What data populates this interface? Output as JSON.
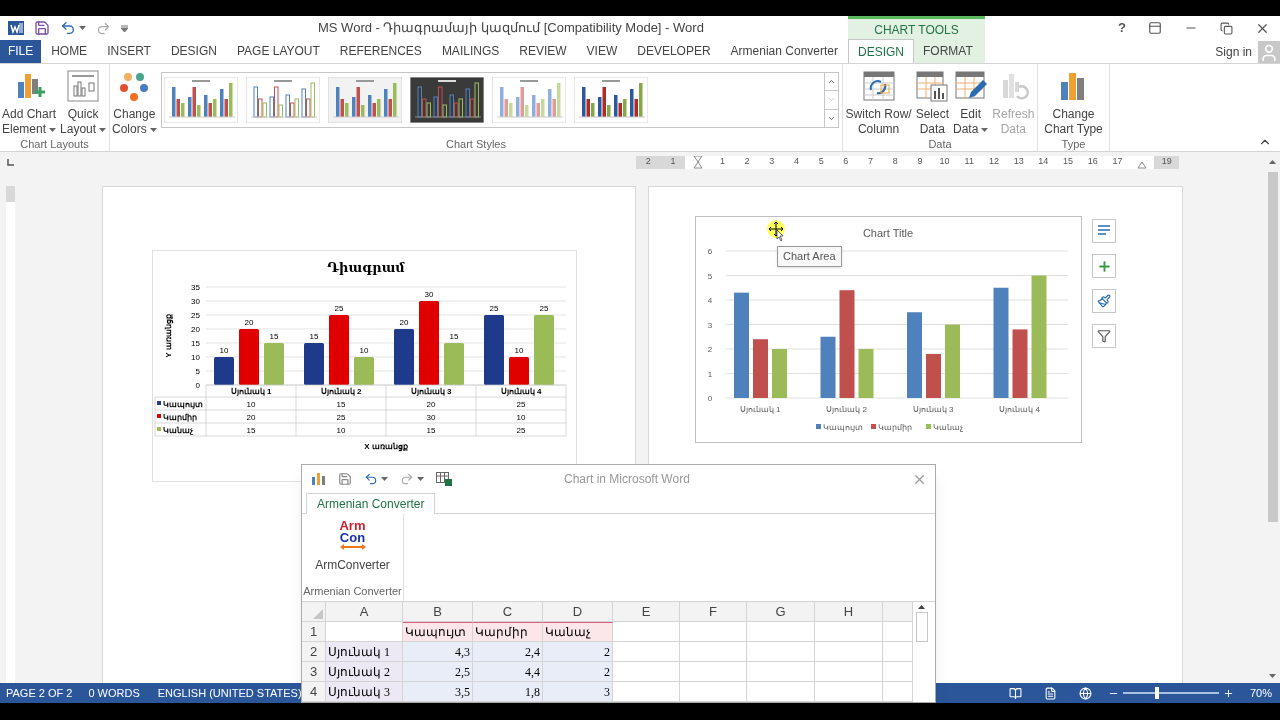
{
  "title_bar": {
    "title": "MS Word - Դիագրամայի կազմում [Compatibility Mode] - Word",
    "context_group": "CHART TOOLS",
    "help": "?"
  },
  "tabs": [
    {
      "label": "FILE",
      "kind": "file",
      "selected": false
    },
    {
      "label": "HOME",
      "kind": "main",
      "selected": false
    },
    {
      "label": "INSERT",
      "kind": "main",
      "selected": false
    },
    {
      "label": "DESIGN",
      "kind": "main",
      "selected": false
    },
    {
      "label": "PAGE LAYOUT",
      "kind": "main",
      "selected": false
    },
    {
      "label": "REFERENCES",
      "kind": "main",
      "selected": false
    },
    {
      "label": "MAILINGS",
      "kind": "main",
      "selected": false
    },
    {
      "label": "REVIEW",
      "kind": "main",
      "selected": false
    },
    {
      "label": "VIEW",
      "kind": "main",
      "selected": false
    },
    {
      "label": "DEVELOPER",
      "kind": "main",
      "selected": false
    },
    {
      "label": "Armenian Converter",
      "kind": "main",
      "selected": false
    },
    {
      "label": "DESIGN",
      "kind": "context",
      "selected": true
    },
    {
      "label": "FORMAT",
      "kind": "context",
      "selected": false
    }
  ],
  "sign_in": "Sign in",
  "chart_layouts": {
    "label": "Chart Layouts",
    "buttons": [
      {
        "kind": "add_element",
        "lines": [
          "Add Chart",
          "Element"
        ],
        "dropdown": true,
        "disabled": false
      },
      {
        "kind": "quick_layout",
        "lines": [
          "Quick",
          "Layout"
        ],
        "dropdown": true,
        "disabled": false
      }
    ]
  },
  "chart_styles": {
    "label": "Chart Styles",
    "buttons": [
      {
        "kind": "change_colors",
        "lines": [
          "Change",
          "Colors"
        ],
        "dropdown": true,
        "disabled": false
      }
    ],
    "styles": [
      {
        "kind": "plain"
      },
      {
        "kind": "outline"
      },
      {
        "kind": "shaded"
      },
      {
        "kind": "dark"
      },
      {
        "kind": "pastel"
      },
      {
        "kind": "bold"
      }
    ]
  },
  "data_group": {
    "label": "Data",
    "buttons": [
      {
        "kind": "switch",
        "lines": [
          "Switch Row/",
          "Column"
        ],
        "dropdown": false,
        "disabled": false
      },
      {
        "kind": "select",
        "lines": [
          "Select",
          "Data"
        ],
        "dropdown": false,
        "disabled": false
      },
      {
        "kind": "edit",
        "lines": [
          "Edit",
          "Data"
        ],
        "dropdown": true,
        "disabled": false
      },
      {
        "kind": "refresh",
        "lines": [
          "Refresh",
          "Data"
        ],
        "dropdown": false,
        "disabled": true
      }
    ]
  },
  "type_group": {
    "label": "Type",
    "buttons": [
      {
        "kind": "change_type",
        "lines": [
          "Change",
          "Chart Type"
        ],
        "dropdown": false,
        "disabled": false
      }
    ]
  },
  "ruler": {
    "labels": [
      "2",
      "1",
      "1",
      "2",
      "3",
      "4",
      "5",
      "6",
      "7",
      "8",
      "9",
      "10",
      "11",
      "12",
      "13",
      "14",
      "15",
      "16",
      "17",
      "19"
    ]
  },
  "page_1": {
    "chart": {
      "chart_data": {
        "type": "bar",
        "title": "Դիագրամ",
        "xlabel": "X առանցք",
        "ylabel": "Y առանցք",
        "categories": [
          "Սյունակ 1",
          "Սյունակ 2",
          "Սյունակ 3",
          "Սյունակ 4"
        ],
        "series": [
          {
            "name": "Կապույտ",
            "color": "#1f3a8a",
            "values": [
              10,
              15,
              20,
              25
            ]
          },
          {
            "name": "Կարմիր",
            "color": "#e00000",
            "values": [
              20,
              25,
              30,
              10
            ]
          },
          {
            "name": "Կանաչ",
            "color": "#9bbb59",
            "values": [
              15,
              10,
              15,
              25
            ]
          }
        ],
        "ylim": [
          0,
          35
        ],
        "yticks": [
          0,
          5,
          10,
          15,
          20,
          25,
          30,
          35
        ],
        "grid": true,
        "legend": "bottom",
        "value_labels": [
          [
            "10",
            "15",
            "20",
            "25"
          ],
          [
            "20",
            "25",
            "30",
            "10"
          ],
          [
            "15",
            "10",
            "15",
            "25"
          ]
        ]
      },
      "data_table": [
        {
          "values": [
            "10",
            "15",
            "20",
            "25"
          ]
        },
        {
          "values": [
            "20",
            "25",
            "30",
            "10"
          ]
        },
        {
          "values": [
            "15",
            "10",
            "15",
            "25"
          ]
        }
      ]
    }
  },
  "page_2": {
    "chart": {
      "chart_data": {
        "type": "bar",
        "title": "Chart Title",
        "categories": [
          "Սյունակ 1",
          "Սյունակ 2",
          "Սյունակ 3",
          "Սյունակ 4"
        ],
        "series": [
          {
            "name": "Կապույտ",
            "color": "#4f81bd",
            "values": [
              4.3,
              2.5,
              3.5,
              4.5
            ]
          },
          {
            "name": "Կարմիր",
            "color": "#c0504d",
            "values": [
              2.4,
              4.4,
              1.8,
              2.8
            ]
          },
          {
            "name": "Կանաչ",
            "color": "#9bbb59",
            "values": [
              2,
              2,
              3,
              5
            ]
          }
        ],
        "ylim": [
          0,
          6
        ],
        "yticks": [
          0,
          1,
          2,
          3,
          4,
          5,
          6
        ],
        "grid": true,
        "legend": "bottom"
      },
      "tooltip": "Chart Area"
    }
  },
  "sheet_window": {
    "title": "Chart in Microsoft Word",
    "tab": {
      "label": "Armenian Converter",
      "selected": true
    },
    "button": {
      "logo_top": "Arm",
      "logo_bottom": "Con",
      "label": "ArmConverter"
    },
    "group_label": "Armenian Converter",
    "columns": [
      "A",
      "B",
      "C",
      "D",
      "E",
      "F",
      "G",
      "H"
    ],
    "rows": [
      {
        "number": "1",
        "cells": [
          {
            "kind": "blank"
          },
          {
            "kind": "series",
            "text": "Կապույտ"
          },
          {
            "kind": "series",
            "text": "Կարմիր"
          },
          {
            "kind": "series",
            "text": "Կանաչ"
          }
        ]
      },
      {
        "number": "2",
        "cells": [
          {
            "kind": "category",
            "text": "Սյունակ 1"
          },
          {
            "kind": "value",
            "text": "4,3"
          },
          {
            "kind": "value",
            "text": "2,4"
          },
          {
            "kind": "value",
            "text": "2"
          }
        ]
      },
      {
        "number": "3",
        "cells": [
          {
            "kind": "category",
            "text": "Սյունակ 2"
          },
          {
            "kind": "value",
            "text": "2,5"
          },
          {
            "kind": "value",
            "text": "4,4"
          },
          {
            "kind": "value",
            "text": "2"
          }
        ]
      },
      {
        "number": "4",
        "cells": [
          {
            "kind": "category",
            "text": "Սյունակ 3"
          },
          {
            "kind": "value",
            "text": "3,5"
          },
          {
            "kind": "value",
            "text": "1,8"
          },
          {
            "kind": "value",
            "text": "3"
          }
        ]
      }
    ]
  },
  "status_bar": {
    "page": "PAGE 2 OF 2",
    "words": "0 WORDS",
    "language": "ENGLISH (UNITED STATES)",
    "zoom": "70%",
    "zoom_slider": {
      "level": 0.35
    }
  }
}
